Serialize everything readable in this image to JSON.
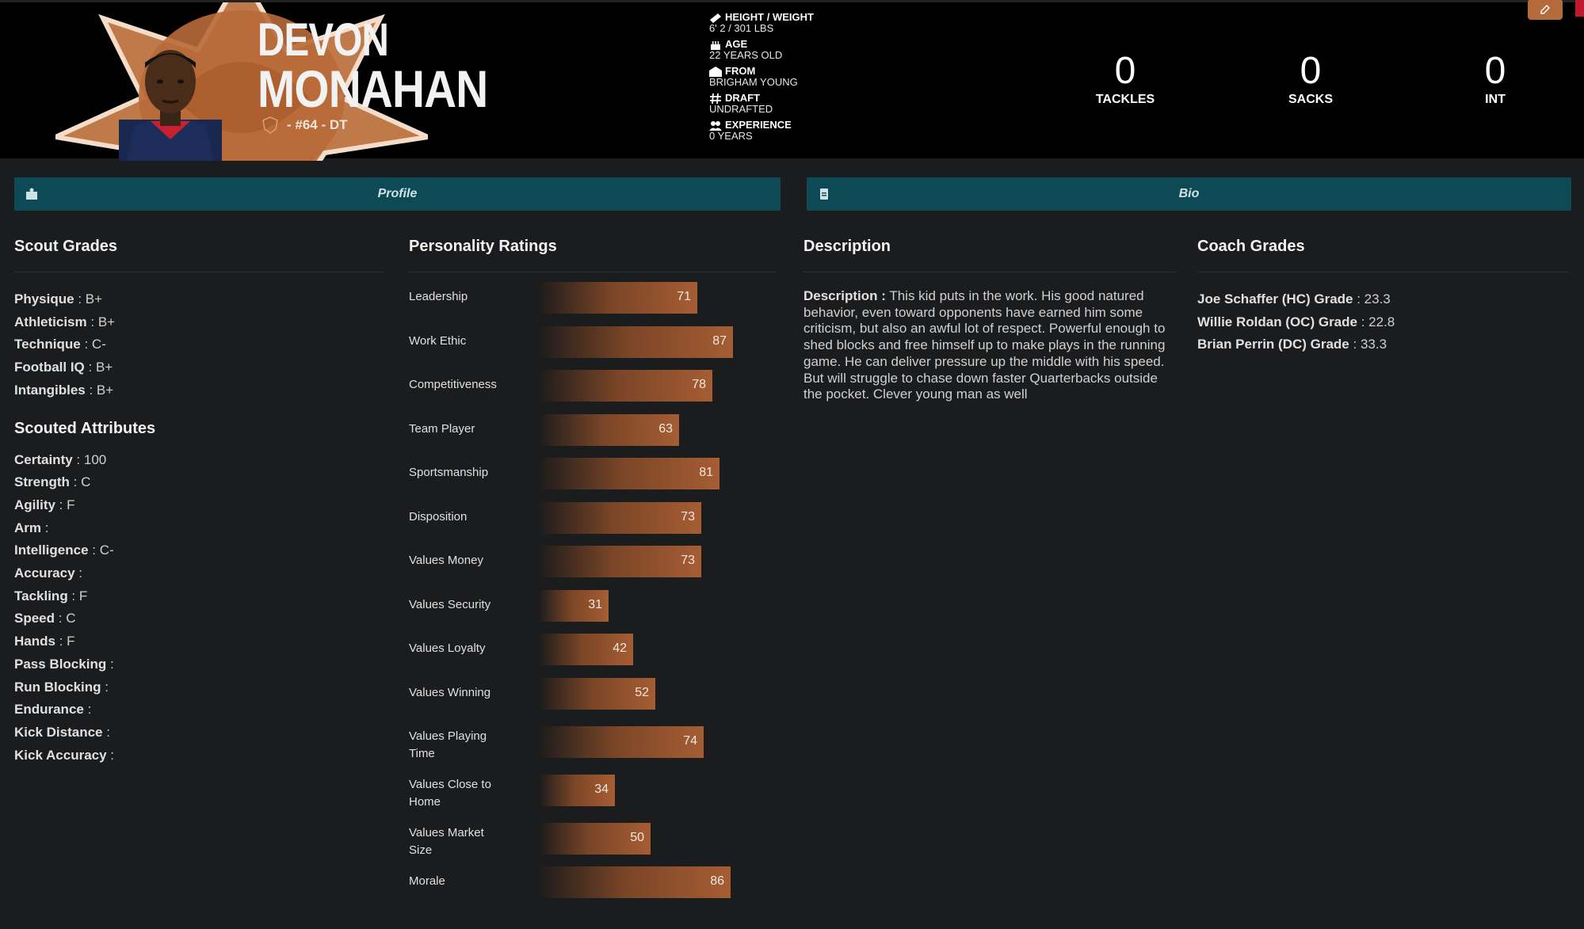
{
  "player": {
    "first_name": "DEVON",
    "last_name": "MONAHAN",
    "jersey": "- #64 - DT"
  },
  "info": [
    {
      "icon": "ruler-icon",
      "label": "HEIGHT / WEIGHT",
      "value": "6' 2 / 301 LBS"
    },
    {
      "icon": "birthday-cake-icon",
      "label": "AGE",
      "value": "22 YEARS OLD"
    },
    {
      "icon": "school-icon",
      "label": "FROM",
      "value": "BRIGHAM YOUNG"
    },
    {
      "icon": "hashtag-icon",
      "label": "DRAFT",
      "value": "UNDRAFTED"
    },
    {
      "icon": "users-icon",
      "label": "EXPERIENCE",
      "value": "0 YEARS"
    }
  ],
  "stats": [
    {
      "value": "0",
      "label": "TACKLES"
    },
    {
      "value": "0",
      "label": "SACKS"
    },
    {
      "value": "0",
      "label": "INT"
    }
  ],
  "tabs": {
    "profile": "Profile",
    "bio": "Bio"
  },
  "scout_grades": {
    "title": "Scout Grades",
    "items": [
      {
        "label": "Physique",
        "value": "B+"
      },
      {
        "label": "Athleticism",
        "value": "B+"
      },
      {
        "label": "Technique",
        "value": "C-"
      },
      {
        "label": "Football IQ",
        "value": "B+"
      },
      {
        "label": "Intangibles",
        "value": "B+"
      }
    ]
  },
  "scouted_attributes": {
    "title": "Scouted Attributes",
    "items": [
      {
        "label": "Certainty",
        "value": "100"
      },
      {
        "label": "Strength",
        "value": "C"
      },
      {
        "label": "Agility",
        "value": "F"
      },
      {
        "label": "Arm",
        "value": ""
      },
      {
        "label": "Intelligence",
        "value": "C-"
      },
      {
        "label": "Accuracy",
        "value": ""
      },
      {
        "label": "Tackling",
        "value": "F"
      },
      {
        "label": "Speed",
        "value": "C"
      },
      {
        "label": "Hands",
        "value": "F"
      },
      {
        "label": "Pass Blocking",
        "value": ""
      },
      {
        "label": "Run Blocking",
        "value": ""
      },
      {
        "label": "Endurance",
        "value": ""
      },
      {
        "label": "Kick Distance",
        "value": ""
      },
      {
        "label": "Kick Accuracy",
        "value": ""
      }
    ]
  },
  "personality": {
    "title": "Personality Ratings",
    "max": 100,
    "items": [
      {
        "label": "Leadership",
        "value": 71
      },
      {
        "label": "Work Ethic",
        "value": 87
      },
      {
        "label": "Competitiveness",
        "value": 78
      },
      {
        "label": "Team Player",
        "value": 63
      },
      {
        "label": "Sportsmanship",
        "value": 81
      },
      {
        "label": "Disposition",
        "value": 73
      },
      {
        "label": "Values Money",
        "value": 73
      },
      {
        "label": "Values Security",
        "value": 31
      },
      {
        "label": "Values Loyalty",
        "value": 42
      },
      {
        "label": "Values Winning",
        "value": 52
      },
      {
        "label": "Values Playing Time",
        "value": 74
      },
      {
        "label": "Values Close to Home",
        "value": 34
      },
      {
        "label": "Values Market Size",
        "value": 50
      },
      {
        "label": "Morale",
        "value": 86
      }
    ]
  },
  "description": {
    "title": "Description",
    "label": "Description :",
    "text": "This kid puts in the work. His good natured behavior, even toward opponents have earned him some criticism, but also an awful lot of respect. Powerful enough to shed blocks and free himself up to make plays in the running game. He can deliver pressure up the middle with his speed. But will struggle to chase down faster Quarterbacks outside the pocket. Clever young man as well"
  },
  "coach_grades": {
    "title": "Coach Grades",
    "items": [
      {
        "label": "Joe Schaffer (HC) Grade",
        "value": "23.3"
      },
      {
        "label": "Willie Roldan (OC) Grade",
        "value": "22.8"
      },
      {
        "label": "Brian Perrin (DC) Grade",
        "value": "33.3"
      }
    ]
  },
  "colors": {
    "accent": "#b56a3c",
    "tab_bg": "#0d4a55",
    "page_bg": "#1b1c1e"
  }
}
